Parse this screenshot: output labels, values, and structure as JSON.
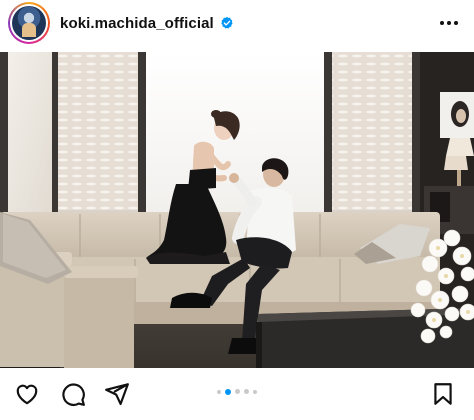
{
  "post": {
    "username": "koki.machida_official",
    "verified": true,
    "avatar_icon": "profile-avatar",
    "more_icon": "more-options-icon"
  },
  "carousel": {
    "total_slides": 5,
    "active_slide": 2
  },
  "actions": {
    "like_icon": "heart-icon",
    "comment_icon": "comment-icon",
    "share_icon": "share-icon",
    "save_icon": "bookmark-icon"
  },
  "colors": {
    "accent": "#0095f6",
    "verified_badge": "#0095f6",
    "text": "#111111"
  }
}
